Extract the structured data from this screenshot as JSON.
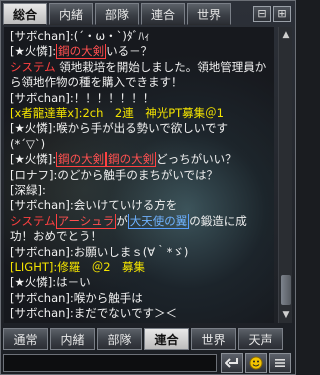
{
  "top_tabs": [
    "総合",
    "内緒",
    "部隊",
    "連合",
    "世界"
  ],
  "top_active_index": 0,
  "log_lines": [
    [
      {
        "t": "[サボchan]:(´・ω・`)ﾀﾞﾊｨ",
        "c": ""
      }
    ],
    [
      {
        "t": "[★火憐]:",
        "c": ""
      },
      {
        "t": "鋼の大剣",
        "c": "tag"
      },
      {
        "t": "いる－？",
        "c": ""
      }
    ],
    [
      {
        "t": "システム",
        "c": "red"
      },
      {
        "t": " 領地栽培を開始しました。領地管理員か",
        "c": ""
      }
    ],
    [
      {
        "t": "ら領地作物の種を購入できます！",
        "c": ""
      }
    ],
    [
      {
        "t": "[サボchan]:！！！！！！！",
        "c": ""
      }
    ],
    [
      {
        "t": "[x者龍達華x]:2ch　2連　神光PT募集＠1",
        "c": "yellow"
      }
    ],
    [
      {
        "t": "[★火憐]:喉から手が出る勢いで欲しいです",
        "c": ""
      }
    ],
    [
      {
        "t": "(*´▽`)",
        "c": ""
      }
    ],
    [
      {
        "t": "[★火憐]:",
        "c": ""
      },
      {
        "t": "鋼の大剣",
        "c": "tag"
      },
      {
        "t": "鋼の大剣",
        "c": "tag"
      },
      {
        "t": "どっちがいい？",
        "c": ""
      }
    ],
    [
      {
        "t": "[ロナフ]:のどから触手のまちがいでは？",
        "c": ""
      }
    ],
    [
      {
        "t": "[深緑]:",
        "c": ""
      }
    ],
    [
      {
        "t": "[サボchan]:会いけていける方を",
        "c": ""
      }
    ],
    [
      {
        "t": "システム",
        "c": "red"
      },
      {
        "t": "アーシュラ",
        "c": "tag"
      },
      {
        "t": "が",
        "c": ""
      },
      {
        "t": "大天使の翼",
        "c": "tag-blue"
      },
      {
        "t": "の鍛造に成",
        "c": ""
      }
    ],
    [
      {
        "t": "功！おめでとう！",
        "c": ""
      }
    ],
    [
      {
        "t": "[サボchan]:お願いしまｓ(∀｀*ゞ)",
        "c": ""
      }
    ],
    [
      {
        "t": "[LIGHT]:修羅　＠2　募集",
        "c": "yellow"
      }
    ],
    [
      {
        "t": "[★火憐]:は－い",
        "c": ""
      }
    ],
    [
      {
        "t": "[サボchan]:喉から触手は",
        "c": ""
      }
    ],
    [
      {
        "t": "[サボchan]:まだでないです＞＜",
        "c": ""
      }
    ]
  ],
  "bottom_tabs": [
    "通常",
    "内緒",
    "部隊",
    "連合",
    "世界",
    "天声"
  ],
  "bottom_active_index": 3,
  "input": {
    "value": "",
    "placeholder": ""
  }
}
